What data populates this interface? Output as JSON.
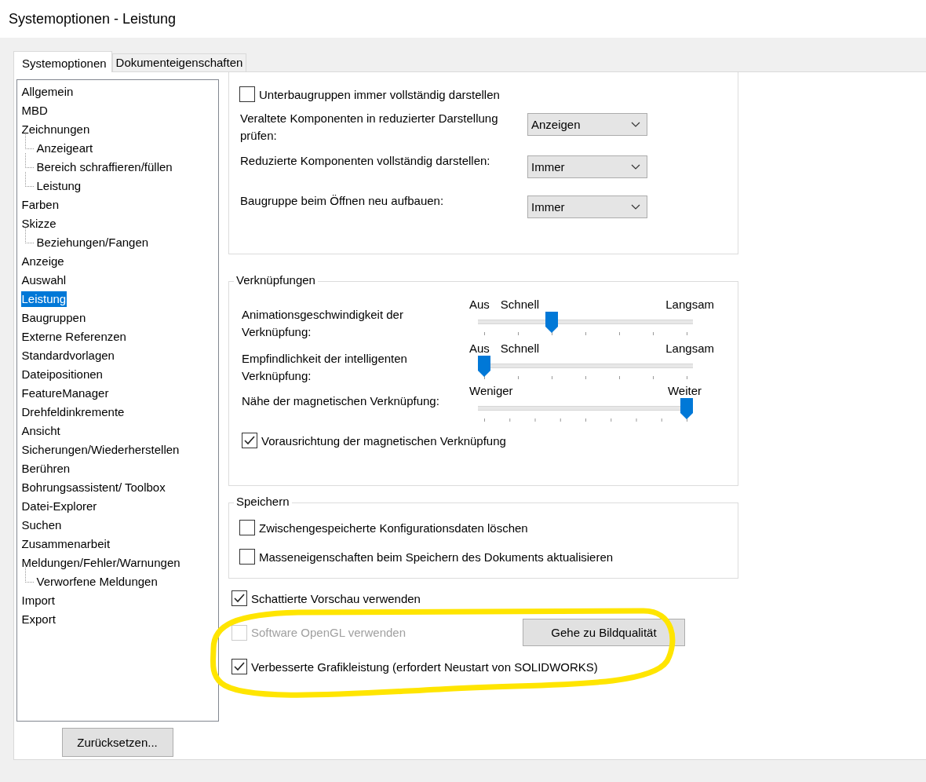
{
  "window": {
    "title": "Systemoptionen - Leistung"
  },
  "tabs": [
    {
      "label": "Systemoptionen",
      "selected": true
    },
    {
      "label": "Dokumenteigenschaften",
      "selected": false
    }
  ],
  "tree": [
    {
      "label": "Allgemein",
      "selected": false
    },
    {
      "label": "MBD",
      "selected": false
    },
    {
      "label": "Zeichnungen",
      "selected": false,
      "children": [
        {
          "label": "Anzeigeart",
          "selected": false
        },
        {
          "label": "Bereich schraffieren/füllen",
          "selected": false
        },
        {
          "label": "Leistung",
          "selected": false
        }
      ]
    },
    {
      "label": "Farben",
      "selected": false
    },
    {
      "label": "Skizze",
      "selected": false,
      "children": [
        {
          "label": "Beziehungen/Fangen",
          "selected": false
        }
      ]
    },
    {
      "label": "Anzeige",
      "selected": false
    },
    {
      "label": "Auswahl",
      "selected": false
    },
    {
      "label": "Leistung",
      "selected": true
    },
    {
      "label": "Baugruppen",
      "selected": false
    },
    {
      "label": "Externe Referenzen",
      "selected": false
    },
    {
      "label": "Standardvorlagen",
      "selected": false
    },
    {
      "label": "Dateipositionen",
      "selected": false
    },
    {
      "label": "FeatureManager",
      "selected": false
    },
    {
      "label": "Drehfeldinkremente",
      "selected": false
    },
    {
      "label": "Ansicht",
      "selected": false
    },
    {
      "label": "Sicherungen/Wiederherstellen",
      "selected": false
    },
    {
      "label": "Berühren",
      "selected": false
    },
    {
      "label": "Bohrungsassistent/ Toolbox",
      "selected": false
    },
    {
      "label": "Datei-Explorer",
      "selected": false
    },
    {
      "label": "Suchen",
      "selected": false
    },
    {
      "label": "Zusammenarbeit",
      "selected": false
    },
    {
      "label": "Meldungen/Fehler/Warnungen",
      "selected": false,
      "children": [
        {
          "label": "Verworfene Meldungen",
          "selected": false
        }
      ]
    },
    {
      "label": "Import",
      "selected": false
    },
    {
      "label": "Export",
      "selected": false
    }
  ],
  "reset_button": "Zurücksetzen...",
  "display_group": {
    "checkboxes": [
      {
        "label": "Unterbaugruppen immer vollständig darstellen",
        "checked": false
      }
    ],
    "dropdowns": [
      {
        "label": "Veraltete Komponenten in reduzierter Darstellung prüfen:",
        "value": "Anzeigen"
      },
      {
        "label": "Reduzierte Komponenten vollständig darstellen:",
        "value": "Immer"
      },
      {
        "label": "Baugruppe beim Öffnen neu aufbauen:",
        "value": "Immer"
      }
    ]
  },
  "mates_group": {
    "title": "Verknüpfungen",
    "sliders": [
      {
        "label": "Animationsgeschwindigkeit der Verknüpfung:",
        "marks": [
          "Aus",
          "Schnell",
          "Langsam"
        ],
        "level": 0.333
      },
      {
        "label": "Empfindlichkeit der intelligenten Verknüpfung:",
        "marks": [
          "Aus",
          "Schnell",
          "Langsam"
        ],
        "level": 0
      },
      {
        "label": "Nähe der magnetischen Verknüpfung:",
        "marks": [
          "Weniger",
          "Weiter"
        ],
        "level": 1
      }
    ],
    "checkboxes": [
      {
        "label": "Vorausrichtung der magnetischen Verknüpfung",
        "checked": true
      }
    ]
  },
  "save_group": {
    "title": "Speichern",
    "checkboxes": [
      {
        "label": "Zwischengespeicherte Konfigurationsdaten löschen",
        "checked": false
      },
      {
        "label": "Masseneigenschaften beim Speichern des Dokuments aktualisieren",
        "checked": false
      }
    ]
  },
  "options": [
    {
      "label": "Schattierte Vorschau verwenden",
      "checked": true,
      "disabled": false
    },
    {
      "label": "Software OpenGL verwenden",
      "checked": false,
      "disabled": true,
      "button": "Gehe zu Bildqualität"
    },
    {
      "label": "Verbesserte Grafikleistung (erfordert Neustart von SOLIDWORKS)",
      "checked": true,
      "disabled": false
    }
  ]
}
